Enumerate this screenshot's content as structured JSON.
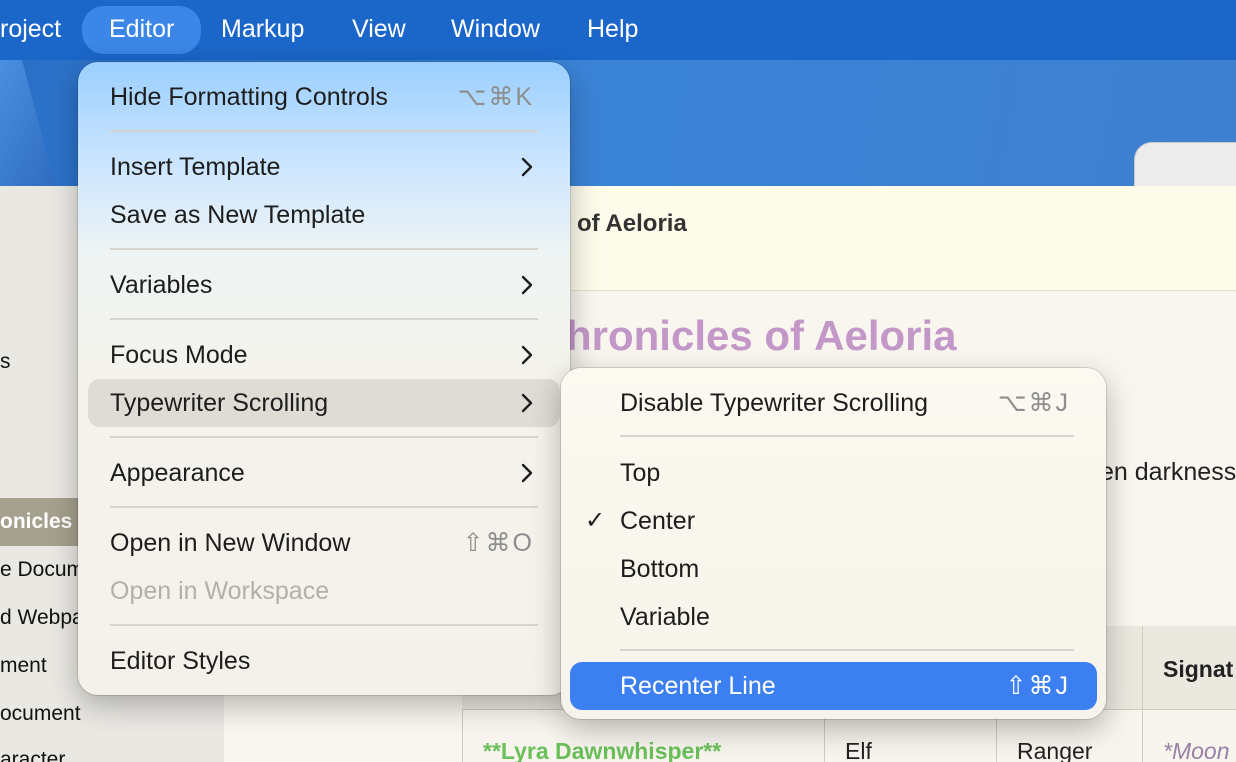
{
  "menubar": {
    "items": [
      "roject",
      "Editor",
      "Markup",
      "View",
      "Window",
      "Help"
    ]
  },
  "sidebar": {
    "items": [
      "s",
      "onicles",
      "e Docum",
      "d Webpa",
      "ment",
      "ocument",
      "aracter"
    ]
  },
  "document": {
    "header_title": "of Aeloria",
    "heading": "hronicles of Aeloria",
    "body_text": "en darkness",
    "table": {
      "headers": [
        "Signat"
      ],
      "row": [
        "**Lyra Dawnwhisper**",
        "Elf",
        "Ranger",
        "*Moon"
      ]
    }
  },
  "editor_menu": {
    "hide_formatting": {
      "label": "Hide Formatting Controls",
      "shortcut": "⌥⌘K"
    },
    "insert_template": "Insert Template",
    "save_template": "Save as New Template",
    "variables": "Variables",
    "focus_mode": "Focus Mode",
    "typewriter": "Typewriter Scrolling",
    "appearance": "Appearance",
    "open_new_window": {
      "label": "Open in New Window",
      "shortcut": "⇧⌘O"
    },
    "open_workspace": "Open in Workspace",
    "editor_styles": "Editor Styles"
  },
  "typewriter_menu": {
    "disable": {
      "label": "Disable Typewriter Scrolling",
      "shortcut": "⌥⌘J"
    },
    "top": "Top",
    "center": "Center",
    "center_check": "✓",
    "bottom": "Bottom",
    "variable": "Variable",
    "recenter": {
      "label": "Recenter Line",
      "shortcut": "⇧⌘J"
    }
  },
  "colors": {
    "menubar": "#1a66c9",
    "highlight": "#3c7ff0",
    "heading": "#c397c8",
    "green_text": "#6bc05a"
  }
}
